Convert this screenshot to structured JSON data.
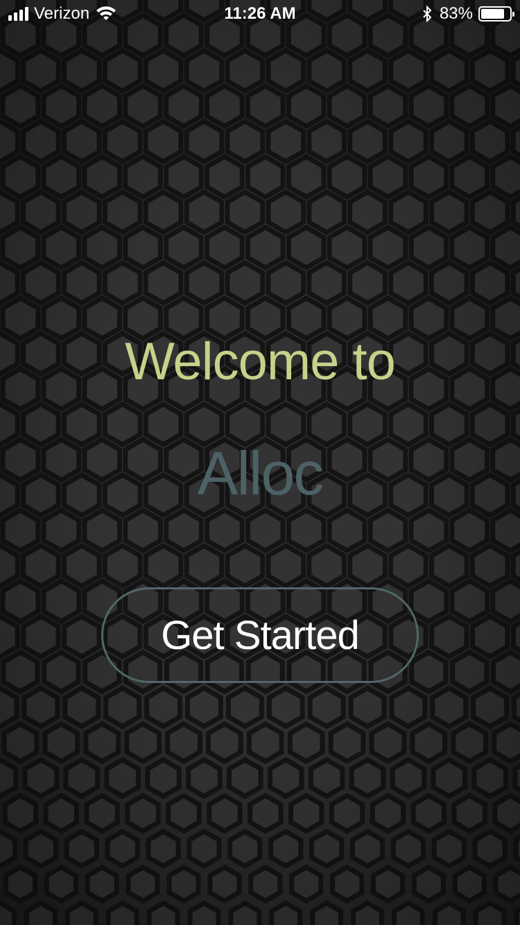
{
  "status_bar": {
    "carrier": "Verizon",
    "time": "11:26 AM",
    "battery_percent": "83%",
    "battery_level": 0.83,
    "signal_icon": "cellular-signal-icon",
    "wifi_icon": "wifi-icon",
    "bluetooth_icon": "bluetooth-icon",
    "battery_icon": "battery-icon"
  },
  "main": {
    "welcome_text": "Welcome to",
    "app_name": "Alloc",
    "get_started_label": "Get Started"
  },
  "colors": {
    "welcome": "#c4d38a",
    "app_name": "#4c6266",
    "button_border": "#51676a",
    "background": "#2e2e2e"
  }
}
